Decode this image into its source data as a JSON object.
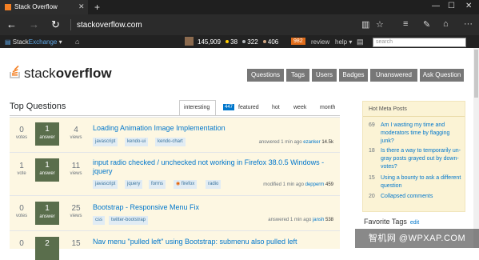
{
  "browser": {
    "tab_title": "Stack Overflow",
    "url": "stackoverflow.com"
  },
  "se_bar": {
    "brand_a": "Stack",
    "brand_b": "Exchange",
    "rep": "145,909",
    "gold": "38",
    "silver": "322",
    "bronze": "406",
    "review_count": "982",
    "review": "review",
    "help": "help",
    "search_placeholder": "search"
  },
  "site": {
    "logo_a": "stack",
    "logo_b": "overflow",
    "nav": [
      "Questions",
      "Tags",
      "Users",
      "Badges",
      "Unanswered",
      "Ask Question"
    ]
  },
  "main": {
    "heading": "Top Questions",
    "filters": [
      "interesting",
      "featured",
      "hot",
      "week",
      "month"
    ],
    "featured_count": "447"
  },
  "questions": [
    {
      "votes": "0",
      "votes_label": "votes",
      "answers": "1",
      "answers_label": "answer",
      "views": "4",
      "views_label": "views",
      "title": "Loading Animation Image Implementation",
      "tags": [
        "javascript",
        "kendo-ui",
        "kendo-chart"
      ],
      "meta": "answered 1 min ago",
      "user": "ezanker",
      "rep": "14.5k"
    },
    {
      "votes": "1",
      "votes_label": "vote",
      "answers": "1",
      "answers_label": "answer",
      "views": "11",
      "views_label": "views",
      "title": "input radio checked / unchecked not working in Firefox 38.0.5 Windows - jquery",
      "tags": [
        "javascript",
        "jquery",
        "forms",
        "firefox",
        "radio"
      ],
      "meta": "modified 1 min ago",
      "user": "depperm",
      "rep": "459"
    },
    {
      "votes": "0",
      "votes_label": "votes",
      "answers": "1",
      "answers_label": "answer",
      "views": "25",
      "views_label": "views",
      "title": "Bootstrap - Responsive Menu Fix",
      "tags": [
        "css",
        "twitter-bootstrap"
      ],
      "meta": "answered 1 min ago",
      "user": "jansh",
      "rep": "538"
    },
    {
      "votes": "0",
      "votes_label": "votes",
      "answers": "2",
      "answers_label": "answers",
      "views": "15",
      "views_label": "views",
      "title": "Nav menu \"pulled left\" using Bootstrap: submenu also pulled left",
      "tags": [],
      "meta": "",
      "user": "",
      "rep": ""
    }
  ],
  "sidebar": {
    "heading": "Hot Meta Posts",
    "items": [
      {
        "count": "69",
        "title": "Am I wasting my time and moderators time by flagging junk?"
      },
      {
        "count": "18",
        "title": "Is there a way to temporarily un-gray posts grayed out by down-votes?"
      },
      {
        "count": "15",
        "title": "Using a bounty to ask a different question"
      },
      {
        "count": "20",
        "title": "Collapsed comments"
      }
    ],
    "favorite_tags": "Favorite Tags",
    "edit": "edit"
  },
  "watermark": "智机网 @WPXAP.COM",
  "colors": {
    "accent": "#f48024",
    "link": "#0077cc",
    "answered": "#5a6e4c",
    "question_bg": "#fdf7e2"
  }
}
